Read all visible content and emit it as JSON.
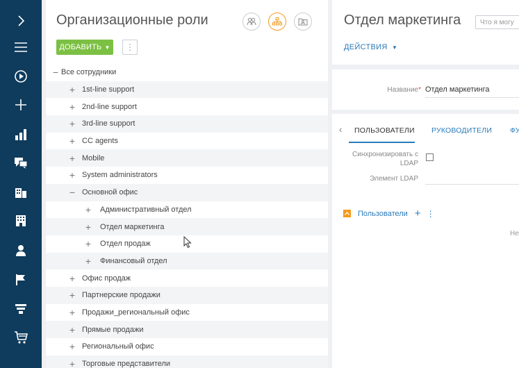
{
  "sidebar": {
    "items": [
      {
        "icon": "chevron-right-icon"
      },
      {
        "icon": "hamburger-menu-icon"
      },
      {
        "icon": "play-circle-icon"
      },
      {
        "icon": "plus-icon"
      },
      {
        "icon": "bar-chart-icon"
      },
      {
        "icon": "chat-bubbles-icon"
      },
      {
        "icon": "contacts-building-icon"
      },
      {
        "icon": "accounts-building-icon"
      },
      {
        "icon": "user-icon"
      },
      {
        "icon": "flag-icon"
      },
      {
        "icon": "funnel-icon"
      },
      {
        "icon": "shopping-cart-icon"
      }
    ]
  },
  "left": {
    "title": "Организационные роли",
    "add_label": "ДОБАВИТЬ",
    "more_label": "⋮",
    "tree": [
      {
        "label": "Все сотрудники",
        "toggle": "−",
        "level": 0,
        "shade": false
      },
      {
        "label": "1st-line support",
        "toggle": "+",
        "level": 1,
        "shade": true
      },
      {
        "label": "2nd-line support",
        "toggle": "+",
        "level": 1,
        "shade": false
      },
      {
        "label": "3rd-line support",
        "toggle": "+",
        "level": 1,
        "shade": true
      },
      {
        "label": "CC agents",
        "toggle": "+",
        "level": 1,
        "shade": false
      },
      {
        "label": "Mobile",
        "toggle": "+",
        "level": 1,
        "shade": true
      },
      {
        "label": "System administrators",
        "toggle": "+",
        "level": 1,
        "shade": false
      },
      {
        "label": "Основной офис",
        "toggle": "−",
        "level": 1,
        "shade": true
      },
      {
        "label": "Административный отдел",
        "toggle": "+",
        "level": 2,
        "shade": false
      },
      {
        "label": "Отдел маркетинга",
        "toggle": "+",
        "level": 2,
        "shade": true
      },
      {
        "label": "Отдел продаж",
        "toggle": "+",
        "level": 2,
        "shade": false
      },
      {
        "label": "Финансовый отдел",
        "toggle": "+",
        "level": 2,
        "shade": true
      },
      {
        "label": "Офис продаж",
        "toggle": "+",
        "level": 1,
        "shade": false
      },
      {
        "label": "Партнерские продажи",
        "toggle": "+",
        "level": 1,
        "shade": true
      },
      {
        "label": "Продажи_региональный офис",
        "toggle": "+",
        "level": 1,
        "shade": false
      },
      {
        "label": "Прямые продажи",
        "toggle": "+",
        "level": 1,
        "shade": true
      },
      {
        "label": "Региональный офис",
        "toggle": "+",
        "level": 1,
        "shade": false
      },
      {
        "label": "Торговые представители",
        "toggle": "+",
        "level": 1,
        "shade": true
      }
    ]
  },
  "right": {
    "title": "Отдел маркетинга",
    "search_placeholder": "Что я могу",
    "actions_label": "ДЕЙСТВИЯ",
    "name_label": "Название",
    "name_required_mark": "*",
    "name_value": "Отдел маркетинга",
    "tabs": [
      {
        "label": "ПОЛЬЗОВАТЕЛИ"
      },
      {
        "label": "РУКОВОДИТЕЛИ"
      },
      {
        "label": "ФУ"
      }
    ],
    "sync_label_line1": "Синхронизировать с",
    "sync_label_line2": "LDAP",
    "ldap_label": "Элемент LDAP",
    "users_title": "Пользователи",
    "users_add": "+",
    "users_more": "⋮",
    "no_data": "Нет д"
  },
  "colors": {
    "sidebar": "#0f3b5c",
    "accent_green": "#7cc043",
    "accent_orange": "#f39b1d",
    "link_blue": "#2a7ab9"
  }
}
